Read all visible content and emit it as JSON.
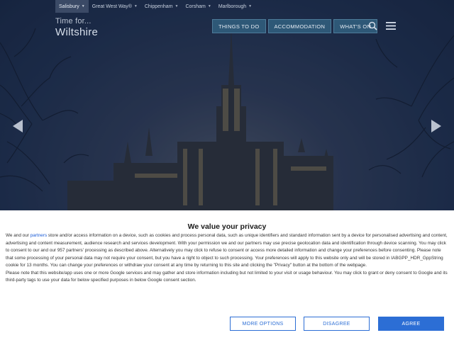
{
  "topnav": {
    "items": [
      {
        "label": "Salisbury",
        "active": true
      },
      {
        "label": "Great West Way®"
      },
      {
        "label": "Chippenham"
      },
      {
        "label": "Corsham"
      },
      {
        "label": "Marlborough"
      }
    ]
  },
  "logo": {
    "line1": "Time for...",
    "line2": "Wiltshire"
  },
  "mainnav": {
    "items": [
      "THINGS TO DO",
      "ACCOMMODATION",
      "WHAT'S ON"
    ]
  },
  "icons": {
    "search": "search-icon",
    "menu": "hamburger-menu-icon",
    "prev": "arrow-left-icon",
    "next": "arrow-right-icon"
  },
  "colors": {
    "accent": "#2c6ed5",
    "nav_button": "#2e5877",
    "hero_sky": "#1b2a47"
  },
  "consent": {
    "title": "We value your privacy",
    "p1_before": "We and our ",
    "p1_link": "partners",
    "p1_after": " store and/or access information on a device, such as cookies and process personal data, such as unique identifiers and standard information sent by a device for personalised advertising and content, advertising and content measurement, audience research and services development. With your permission we and our partners may use precise geolocation data and identification through device scanning. You may click to consent to our and our 957 partners' processing as described above. Alternatively you may click to refuse to consent or access more detailed information and change your preferences before consenting. Please note that some processing of your personal data may not require your consent, but you have a right to object to such processing. Your preferences will apply to this website only and will be stored in IABGPP_HDR_GppString cookie for 13 months. You can change your preferences or withdraw your consent at any time by returning to this site and clicking the \"Privacy\" button at the bottom of the webpage.",
    "p2": "Please note that this website/app uses one or more Google services and may gather and store information including but not limited to your visit or usage behaviour. You may click to grant or deny consent to Google and its third-party tags to use your data for below specified purposes in below Google consent section.",
    "buttons": {
      "more": "MORE OPTIONS",
      "disagree": "DISAGREE",
      "agree": "AGREE"
    }
  }
}
